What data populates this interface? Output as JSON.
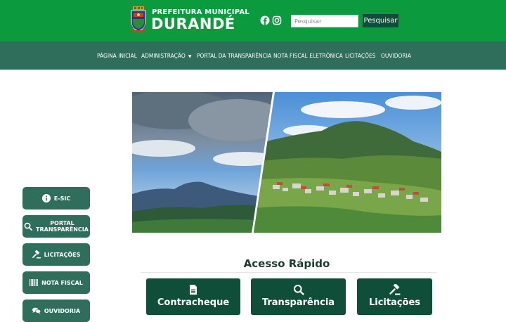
{
  "header": {
    "brand_line1": "PREFEITURA MUNICIPAL",
    "brand_line2": "DURANDÉ",
    "search_placeholder": "Pesquisar",
    "search_button": "Pesquisar",
    "social": [
      "facebook-icon",
      "instagram-icon"
    ],
    "colors": {
      "header": "#0b9a3e",
      "nav": "#2e6e5a",
      "button": "#0f4f3a"
    }
  },
  "nav": {
    "items": [
      {
        "label": "PÁGINA INICIAL"
      },
      {
        "label": "ADMINISTRAÇÃO"
      },
      {
        "label": "PORTAL DA TRANSPARÊNCIA"
      },
      {
        "label": "NOTA FISCAL ELETRÔNICA"
      },
      {
        "label": "LICITAÇÕES"
      },
      {
        "label": "OUVIDORIA"
      }
    ]
  },
  "sidebar": {
    "buttons": [
      {
        "label": "E-SIC",
        "icon": "info-icon"
      },
      {
        "label_line1": "PORTAL",
        "label_line2": "TRANSPARÊNCIA",
        "icon": "search-icon"
      },
      {
        "label": "LICITAÇÕES",
        "icon": "gavel-icon"
      },
      {
        "label": "NOTA FISCAL",
        "icon": "barcode-icon"
      },
      {
        "label": "OUVIDORIA",
        "icon": "chat-icon"
      }
    ]
  },
  "quick_access": {
    "title": "Acesso Rápido",
    "cards": [
      {
        "label": "Contracheque",
        "icon": "document-icon"
      },
      {
        "label": "Transparência",
        "icon": "search-icon"
      },
      {
        "label": "Licitações",
        "icon": "gavel-icon"
      }
    ]
  }
}
